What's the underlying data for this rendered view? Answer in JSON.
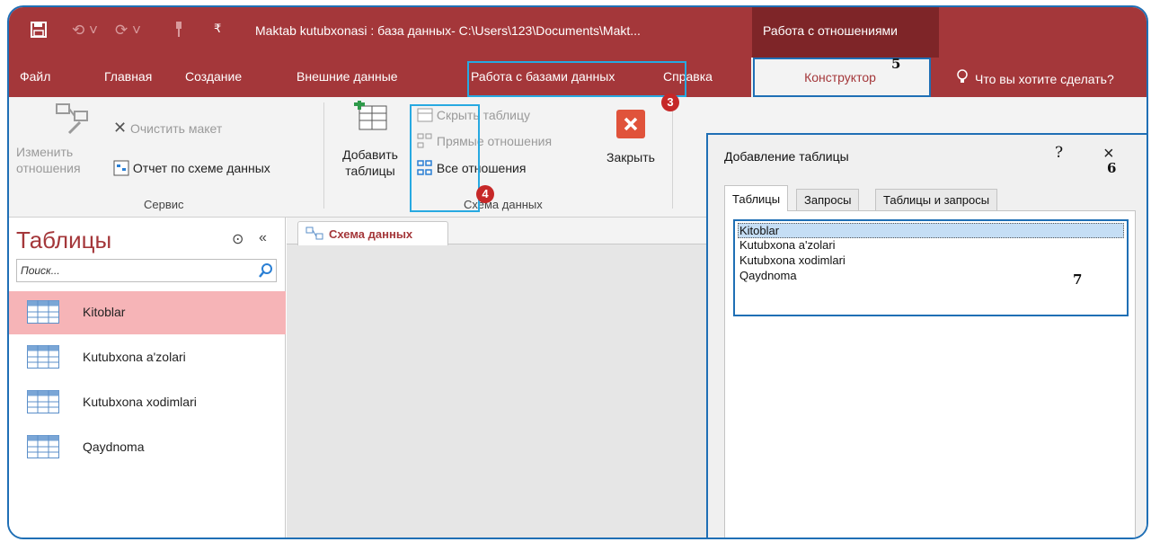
{
  "titlebar": {
    "document_title": "Maktab kutubxonasi : база данных- C:\\Users\\123\\Documents\\Makt...",
    "context_tab": "Работа с отношениями",
    "quick_access": [
      "save-icon",
      "undo-icon",
      "redo-icon",
      "pin-icon",
      "customize-icon"
    ]
  },
  "ribbon_tabs": {
    "items": [
      "Файл",
      "Главная",
      "Создание",
      "Внешние данные",
      "Работа с базами данных",
      "Справка"
    ],
    "active": "Конструктор",
    "tell_me": "Что вы хотите сделать?"
  },
  "ribbon": {
    "tools_group": {
      "edit_relationships": "Изменить отношения",
      "edit_relationships_l1": "Изменить",
      "edit_relationships_l2": "отношения",
      "clear_layout": "Очистить макет",
      "relationship_report": "Отчет по схеме данных",
      "label": "Сервис"
    },
    "relationships_group": {
      "add_tables_l1": "Добавить",
      "add_tables_l2": "таблицы",
      "hide_table": "Скрыть таблицу",
      "direct_relationships": "Прямые отношения",
      "all_relationships": "Все отношения",
      "close": "Закрыть",
      "label": "Схема данных"
    }
  },
  "navigation": {
    "title": "Таблицы",
    "search_placeholder": "Поиск...",
    "items": [
      {
        "label": "Kitoblar",
        "selected": true
      },
      {
        "label": "Kutubxona a'zolari",
        "selected": false
      },
      {
        "label": "Kutubxona xodimlari",
        "selected": false
      },
      {
        "label": "Qaydnoma",
        "selected": false
      }
    ]
  },
  "document_tab": {
    "label": "Схема данных"
  },
  "dialog": {
    "title": "Добавление таблицы",
    "help": "?",
    "close": "×",
    "tabs": [
      "Таблицы",
      "Запросы",
      "Таблицы и запросы"
    ],
    "active_tab": "Таблицы",
    "list": [
      "Kitoblar",
      "Kutubxona a'zolari",
      "Kutubxona xodimlari",
      "Qaydnoma"
    ],
    "selected": "Kitoblar"
  },
  "annotations": {
    "badge_3": "3",
    "badge_4": "4",
    "num_5": "5",
    "num_6": "6",
    "num_7": "7"
  },
  "colors": {
    "access_brand": "#a4373a",
    "context_tab": "#7e2528",
    "highlight": "#27a9e1",
    "badge": "#c62828",
    "selection": "#f6b4b7"
  }
}
